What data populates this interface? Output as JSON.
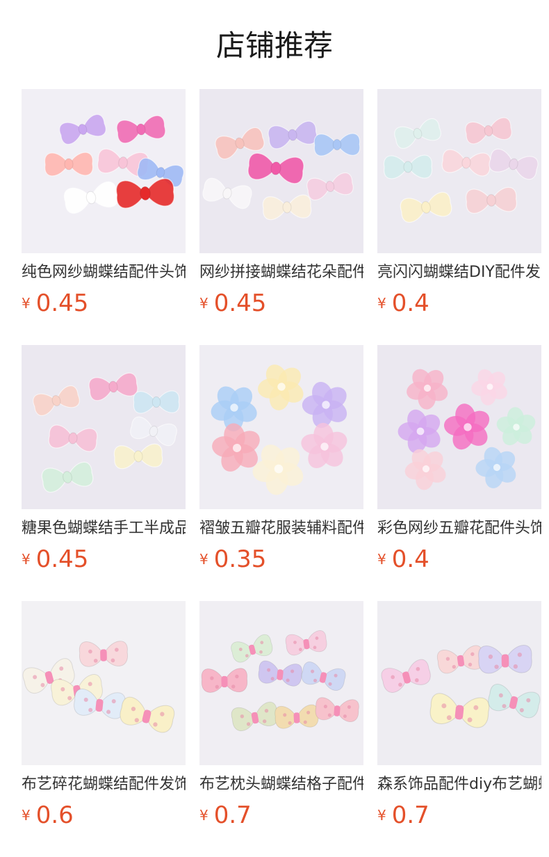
{
  "section": {
    "title": "店铺推荐"
  },
  "products": [
    {
      "name": "纯色网纱蝴蝶结配件头饰材料",
      "currency": "¥",
      "price": "0.45",
      "bg": "#f1eff5",
      "kind": "bow",
      "items": [
        {
          "c": "#c9a6f0",
          "s": 0.95
        },
        {
          "c": "#f06cb4",
          "s": 1.0
        },
        {
          "c": "#ffb6b0",
          "s": 1.0
        },
        {
          "c": "#f8c4d8",
          "s": 1.05
        },
        {
          "c": "#9fb9f5",
          "s": 0.95
        },
        {
          "c": "#ffffff",
          "s": 1.1
        },
        {
          "c": "#e52a2a",
          "s": 1.2
        }
      ]
    },
    {
      "name": "网纱拼接蝴蝶结花朵配件",
      "currency": "¥",
      "price": "0.45",
      "bg": "#ebe8f0",
      "kind": "bow",
      "items": [
        {
          "c": "#f7c2bc",
          "s": 1.0
        },
        {
          "c": "#c9b6f0",
          "s": 1.0
        },
        {
          "c": "#a9c6f5",
          "s": 0.95
        },
        {
          "c": "#f05aa8",
          "s": 1.15
        },
        {
          "c": "#f8f6f8",
          "s": 1.0
        },
        {
          "c": "#f5cde0",
          "s": 0.95
        },
        {
          "c": "#f9eedc",
          "s": 1.0
        }
      ]
    },
    {
      "name": "亮闪闪蝴蝶结DIY配件发夹",
      "currency": "¥",
      "price": "0.4",
      "bg": "#eceaf1",
      "kind": "bow",
      "items": [
        {
          "c": "#dff0ec",
          "s": 0.95
        },
        {
          "c": "#f6c7d2",
          "s": 0.95
        },
        {
          "c": "#d4ecec",
          "s": 1.0
        },
        {
          "c": "#fad6dc",
          "s": 1.0
        },
        {
          "c": "#ead6ea",
          "s": 1.0
        },
        {
          "c": "#fbf0c8",
          "s": 1.05
        },
        {
          "c": "#f6d0d4",
          "s": 1.05
        }
      ]
    },
    {
      "name": "糖果色蝴蝶结手工半成品配件",
      "currency": "¥",
      "price": "0.45",
      "bg": "#ebe8f0",
      "kind": "bow",
      "items": [
        {
          "c": "#f8d2c8",
          "s": 0.95
        },
        {
          "c": "#f5aacb",
          "s": 1.0
        },
        {
          "c": "#cde6f2",
          "s": 0.95
        },
        {
          "c": "#f6c0d6",
          "s": 1.0
        },
        {
          "c": "#f1f1f6",
          "s": 0.95
        },
        {
          "c": "#d4eedc",
          "s": 1.05
        },
        {
          "c": "#f8f1cc",
          "s": 1.0
        }
      ]
    },
    {
      "name": "褶皱五瓣花服装辅料配件",
      "currency": "¥",
      "price": "0.35",
      "bg": "#efedf3",
      "kind": "flower",
      "items": [
        {
          "c": "#a9cdf6",
          "s": 0.95
        },
        {
          "c": "#fbeab0",
          "s": 0.95
        },
        {
          "c": "#c8b2f2",
          "s": 0.95
        },
        {
          "c": "#f8aab8",
          "s": 1.0
        },
        {
          "c": "#f6c2dc",
          "s": 0.95
        },
        {
          "c": "#fbf1d6",
          "s": 1.05
        }
      ]
    },
    {
      "name": "彩色网纱五瓣花配件头饰",
      "currency": "¥",
      "price": "0.4",
      "bg": "#ebe8f0",
      "kind": "flower",
      "items": [
        {
          "c": "#f8b2c8",
          "s": 0.85
        },
        {
          "c": "#fbd6e6",
          "s": 0.75
        },
        {
          "c": "#d4a6f0",
          "s": 0.9
        },
        {
          "c": "#f56cc0",
          "s": 0.95
        },
        {
          "c": "#ccefdc",
          "s": 0.8
        },
        {
          "c": "#fad0d8",
          "s": 0.85
        },
        {
          "c": "#b6d4f6",
          "s": 0.85
        }
      ]
    },
    {
      "name": "布艺碎花蝴蝶结配件发饰",
      "currency": "¥",
      "price": "0.6",
      "bg": "#f2f1f4",
      "kind": "puff",
      "items": [
        {
          "c": "#f6f2e8",
          "s": 1.0
        },
        {
          "c": "#f8f2d8",
          "s": 1.0
        },
        {
          "c": "#f8d8dc",
          "s": 0.95
        },
        {
          "c": "#e2ecf8",
          "s": 1.0
        },
        {
          "c": "#f9f0c8",
          "s": 1.05
        }
      ]
    },
    {
      "name": "布艺枕头蝴蝶结格子配件",
      "currency": "¥",
      "price": "0.7",
      "bg": "#f0eef3",
      "kind": "puff",
      "items": [
        {
          "c": "#dcedd6",
          "s": 0.8
        },
        {
          "c": "#f6cfe0",
          "s": 0.8
        },
        {
          "c": "#f7b6c8",
          "s": 0.9
        },
        {
          "c": "#cfc6f0",
          "s": 0.85
        },
        {
          "c": "#cfd8f4",
          "s": 0.85
        },
        {
          "c": "#dfe6c8",
          "s": 0.9
        },
        {
          "c": "#f2dcb0",
          "s": 0.85
        },
        {
          "c": "#f7c2cc",
          "s": 0.85
        }
      ]
    },
    {
      "name": "森系饰品配件diy布艺蝴蝶结",
      "currency": "¥",
      "price": "0.7",
      "bg": "#eeedf2",
      "kind": "puff",
      "items": [
        {
          "c": "#f6cfe6",
          "s": 0.95
        },
        {
          "c": "#f8d8d8",
          "s": 0.9
        },
        {
          "c": "#d8d4f4",
          "s": 1.05
        },
        {
          "c": "#f9f2c8",
          "s": 1.15
        },
        {
          "c": "#d4ecea",
          "s": 1.0
        }
      ]
    }
  ]
}
